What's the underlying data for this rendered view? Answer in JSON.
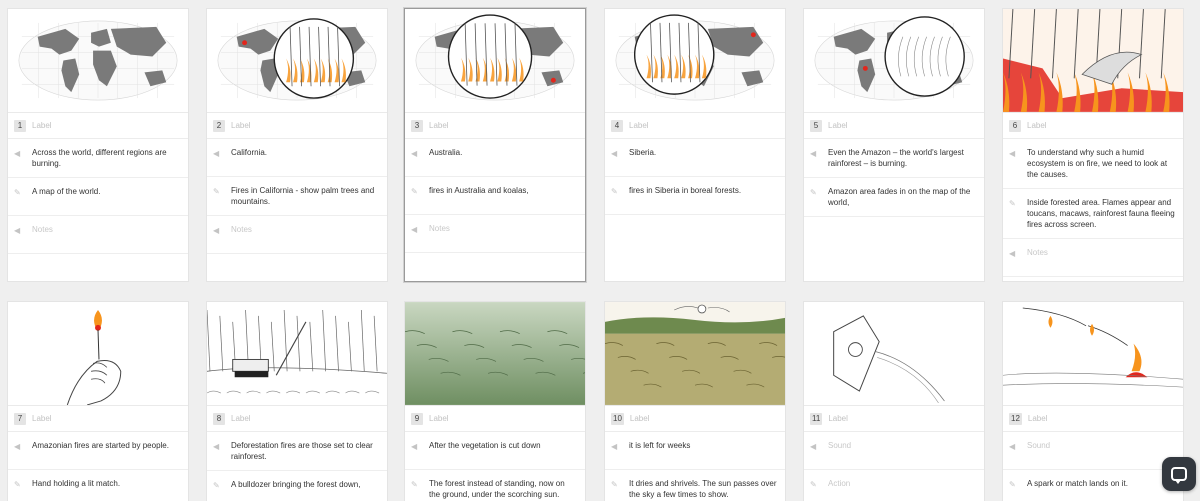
{
  "panels": [
    {
      "num": "1",
      "label": "Label",
      "lines": [
        {
          "icon": "dialogue",
          "text": "Across the world, different regions are burning."
        },
        {
          "icon": "action",
          "text": "A map of the world."
        },
        {
          "icon": "notes",
          "text": "Notes",
          "placeholder": true
        }
      ]
    },
    {
      "num": "2",
      "label": "Label",
      "lines": [
        {
          "icon": "dialogue",
          "text": "California."
        },
        {
          "icon": "action",
          "text": "Fires in California - show palm trees and mountains."
        },
        {
          "icon": "notes",
          "text": "Notes",
          "placeholder": true
        }
      ]
    },
    {
      "num": "3",
      "label": "Label",
      "lines": [
        {
          "icon": "dialogue",
          "text": "Australia."
        },
        {
          "icon": "action",
          "text": "fires in Australia and koalas,"
        },
        {
          "icon": "notes",
          "text": "Notes",
          "placeholder": true
        }
      ]
    },
    {
      "num": "4",
      "label": "Label",
      "lines": [
        {
          "icon": "dialogue",
          "text": "Siberia."
        },
        {
          "icon": "action",
          "text": "fires in Siberia in boreal forests."
        }
      ]
    },
    {
      "num": "5",
      "label": "Label",
      "lines": [
        {
          "icon": "dialogue",
          "text": "Even the Amazon – the world's largest rainforest – is burning."
        },
        {
          "icon": "action",
          "text": "Amazon area fades in on the map of the world,"
        }
      ]
    },
    {
      "num": "6",
      "label": "Label",
      "lines": [
        {
          "icon": "dialogue",
          "text": "To understand why such a humid ecosystem is on fire, we need to look at the causes."
        },
        {
          "icon": "action",
          "text": "Inside forested area. Flames appear and toucans, macaws, rainforest fauna fleeing fires across screen."
        },
        {
          "icon": "notes",
          "text": "Notes",
          "placeholder": true
        }
      ]
    },
    {
      "num": "7",
      "label": "Label",
      "lines": [
        {
          "icon": "dialogue",
          "text": "Amazonian fires are started by people."
        },
        {
          "icon": "action",
          "text": "Hand holding a lit match."
        }
      ]
    },
    {
      "num": "8",
      "label": "Label",
      "lines": [
        {
          "icon": "dialogue",
          "text": "Deforestation fires are those set to clear rainforest."
        },
        {
          "icon": "action",
          "text": "A bulldozer bringing the forest down,"
        }
      ]
    },
    {
      "num": "9",
      "label": "Label",
      "lines": [
        {
          "icon": "dialogue",
          "text": "After the vegetation is cut down"
        },
        {
          "icon": "action",
          "text": "The forest instead of standing, now on the ground, under the scorching sun."
        }
      ]
    },
    {
      "num": "10",
      "label": "Label",
      "lines": [
        {
          "icon": "dialogue",
          "text": "it is left for weeks"
        },
        {
          "icon": "action",
          "text": "It dries and shrivels. The sun passes over the sky a few times to show."
        }
      ]
    },
    {
      "num": "11",
      "label": "Label",
      "lines": [
        {
          "icon": "dialogue",
          "text": "Sound",
          "placeholder": true
        },
        {
          "icon": "action",
          "text": "Action",
          "placeholder": true
        }
      ]
    },
    {
      "num": "12",
      "label": "Label",
      "lines": [
        {
          "icon": "dialogue",
          "text": "Sound",
          "placeholder": true
        },
        {
          "icon": "action",
          "text": "A spark or match lands on it."
        }
      ]
    }
  ],
  "colors": {
    "fire": "#f7941d",
    "fire_red": "#e2261c",
    "land": "#7a7a7a",
    "forest_green": "#6f8f62",
    "dry_field": "#a29a55"
  },
  "chat_button": {
    "icon": "chat-bubble-icon"
  }
}
